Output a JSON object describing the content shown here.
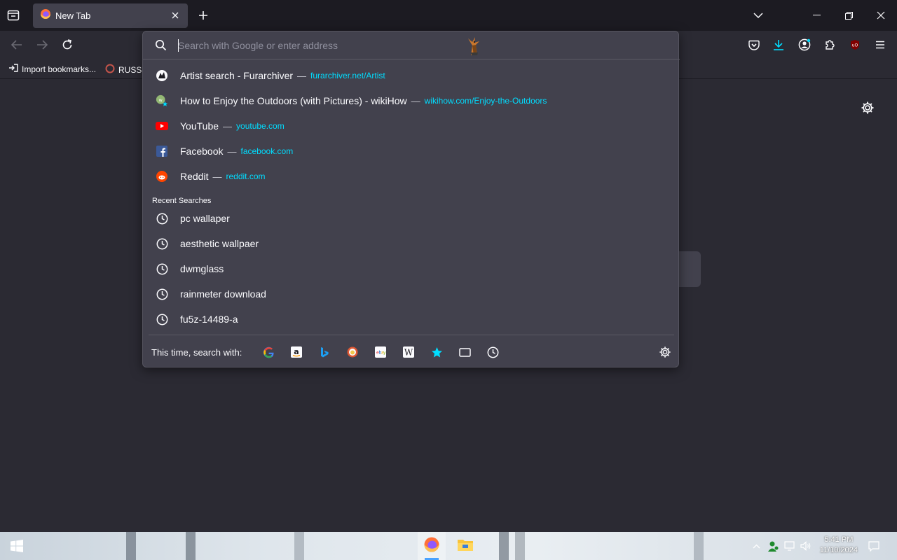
{
  "tab": {
    "label": "New Tab"
  },
  "urlbar": {
    "placeholder": "Search with Google or enter address"
  },
  "bookmarks": [
    {
      "label": "Import bookmarks..."
    },
    {
      "label": "RUSSIA"
    }
  ],
  "suggestions": [
    {
      "title": "Artist search - Furarchiver",
      "url": "furarchiver.net/Artist",
      "icon": "furarchiver-icon"
    },
    {
      "title": "How to Enjoy the Outdoors (with Pictures) - wikiHow",
      "url": "wikihow.com/Enjoy-the-Outdoors",
      "icon": "wikihow-icon"
    },
    {
      "title": "YouTube",
      "url": "youtube.com",
      "icon": "youtube-icon"
    },
    {
      "title": "Facebook",
      "url": "facebook.com",
      "icon": "facebook-icon"
    },
    {
      "title": "Reddit",
      "url": "reddit.com",
      "icon": "reddit-icon"
    }
  ],
  "separator": "—",
  "recent_label": "Recent Searches",
  "recent_searches": [
    "pc wallaper",
    "aesthetic wallpaer",
    "dwmglass",
    "rainmeter download",
    "fu5z-14489-a"
  ],
  "oneoff": {
    "label": "This time, search with:",
    "engines": [
      "google",
      "amazon",
      "bing",
      "duckduckgo",
      "ebay",
      "wikipedia",
      "bookmarks",
      "tabs",
      "history"
    ]
  },
  "clock": {
    "time": "5:41 PM",
    "date": "11/10/2024"
  },
  "colors": {
    "accent": "#00ddff",
    "panel": "#42414d",
    "background": "#2b2a33",
    "tabstrip": "#1c1b22"
  }
}
